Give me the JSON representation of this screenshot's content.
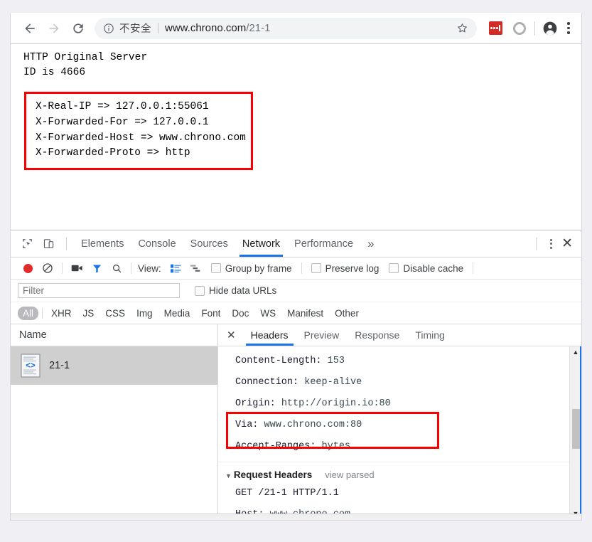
{
  "browser": {
    "nav": {
      "back_label": "Back",
      "forward_label": "Forward",
      "reload_label": "Reload"
    },
    "omnibox": {
      "security_icon": "info-circle-icon",
      "security_text": "不安全",
      "url_host": "www.chrono.com",
      "url_path": "/21-1",
      "star_label": "Bookmark this page"
    },
    "actions": {
      "extension_label": "LastPass",
      "second_extension_label": "Extension",
      "profile_label": "Profile",
      "menu_label": "Customize and control Google Chrome"
    }
  },
  "page": {
    "line1": "HTTP Original Server",
    "line2": "ID is 4666",
    "headers_box": [
      "X-Real-IP => 127.0.0.1:55061",
      "X-Forwarded-For => 127.0.0.1",
      "X-Forwarded-Host => www.chrono.com",
      "X-Forwarded-Proto => http"
    ],
    "highlight_color": "#fa0000"
  },
  "devtools": {
    "inspect_icon": "inspect-element-icon",
    "device_icon": "device-toolbar-icon",
    "tabs": [
      {
        "label": "Elements",
        "active": false
      },
      {
        "label": "Console",
        "active": false
      },
      {
        "label": "Sources",
        "active": false
      },
      {
        "label": "Network",
        "active": true
      },
      {
        "label": "Performance",
        "active": false
      }
    ],
    "more_tabs": "»",
    "menu_label": "More options",
    "close_label": "✕",
    "network_toolbar": {
      "record_label": "Record",
      "clear_label": "Clear",
      "screenshot_label": "Capture screenshots",
      "filter_label": "Filter",
      "search_label": "Search",
      "view_label": "View:",
      "list_view_label": "List view",
      "waterfall_label": "Waterfall",
      "checkboxes": [
        {
          "label": "Group by frame",
          "checked": false
        },
        {
          "label": "Preserve log",
          "checked": false
        },
        {
          "label": "Disable cache",
          "checked": false
        }
      ]
    },
    "filter_row": {
      "filter_placeholder": "Filter",
      "filter_value": "",
      "hide_data_urls_label": "Hide data URLs",
      "hide_data_urls_checked": false
    },
    "type_filters": [
      {
        "label": "All",
        "active": true
      },
      {
        "label": "XHR",
        "active": false
      },
      {
        "label": "JS",
        "active": false
      },
      {
        "label": "CSS",
        "active": false
      },
      {
        "label": "Img",
        "active": false
      },
      {
        "label": "Media",
        "active": false
      },
      {
        "label": "Font",
        "active": false
      },
      {
        "label": "Doc",
        "active": false
      },
      {
        "label": "WS",
        "active": false
      },
      {
        "label": "Manifest",
        "active": false
      },
      {
        "label": "Other",
        "active": false
      }
    ],
    "requests": {
      "column_header": "Name",
      "rows": [
        {
          "name": "21-1",
          "icon": "document-code-icon",
          "selected": true
        }
      ]
    },
    "detail": {
      "close_label": "✕",
      "tabs": [
        {
          "label": "Headers",
          "active": true
        },
        {
          "label": "Preview",
          "active": false
        },
        {
          "label": "Response",
          "active": false
        },
        {
          "label": "Timing",
          "active": false
        }
      ],
      "response_headers": [
        {
          "name": "Content-Length:",
          "value": "153",
          "highlighted": false
        },
        {
          "name": "Connection:",
          "value": "keep-alive",
          "highlighted": false
        },
        {
          "name": "Origin:",
          "value": "http://origin.io:80",
          "highlighted": true
        },
        {
          "name": "Via:",
          "value": "www.chrono.com:80",
          "highlighted": true
        },
        {
          "name": "Accept-Ranges:",
          "value": "bytes",
          "highlighted": false
        }
      ],
      "request_section": {
        "triangle": "▼",
        "title": "Request Headers",
        "view_parsed": "view parsed",
        "lines": [
          {
            "name": "GET /21-1 HTTP/1.1",
            "value": ""
          },
          {
            "name": "Host:",
            "value": "www.chrono.com"
          }
        ]
      },
      "scrollbar": {
        "up_arrow": "▲",
        "down_arrow": "▼"
      }
    }
  },
  "colors": {
    "accent": "#1a73e8",
    "highlight": "#fa0000",
    "record": "#e22b2b",
    "selection": "#cfcfcf"
  }
}
